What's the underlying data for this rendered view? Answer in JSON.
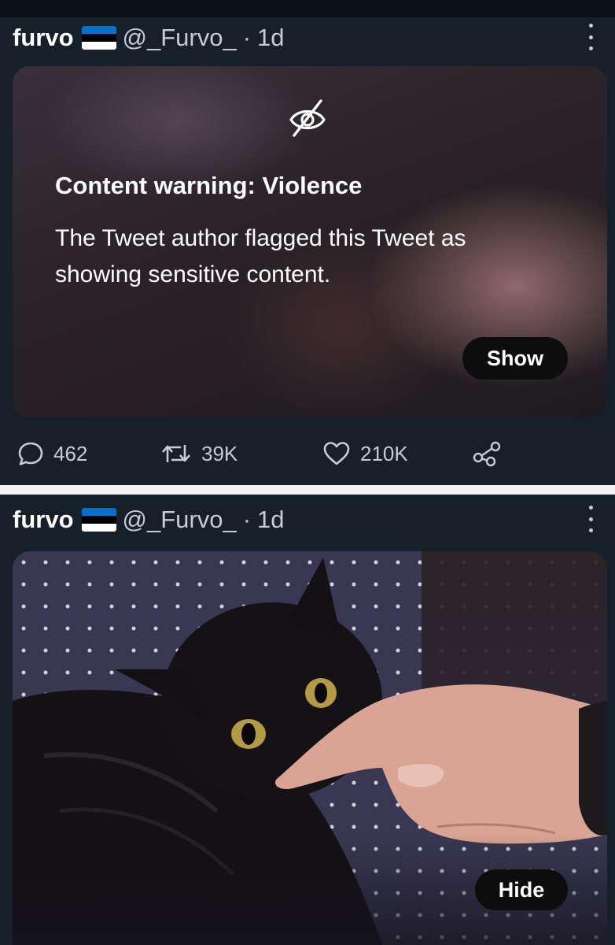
{
  "tweets": [
    {
      "author": {
        "name": "furvo",
        "handle": "@_Furvo_",
        "time": "1d",
        "separator": "·"
      },
      "flag_colors": [
        "#0072ce",
        "#000000",
        "#ffffff"
      ],
      "content_warning": {
        "icon": "eye-slash-icon",
        "title": "Content warning: Violence",
        "description": "The Tweet author flagged this Tweet as showing sensitive content.",
        "button": "Show"
      },
      "actions": {
        "replies": "462",
        "retweets": "39K",
        "likes": "210K"
      }
    },
    {
      "author": {
        "name": "furvo",
        "handle": "@_Furvo_",
        "time": "1d",
        "separator": "·"
      },
      "flag_colors": [
        "#0072ce",
        "#000000",
        "#ffffff"
      ],
      "media": {
        "button": "Hide"
      }
    }
  ],
  "colors": {
    "background": "#15202b",
    "secondary_text": "#c4ccd4",
    "divider": "#f2f2f2"
  }
}
